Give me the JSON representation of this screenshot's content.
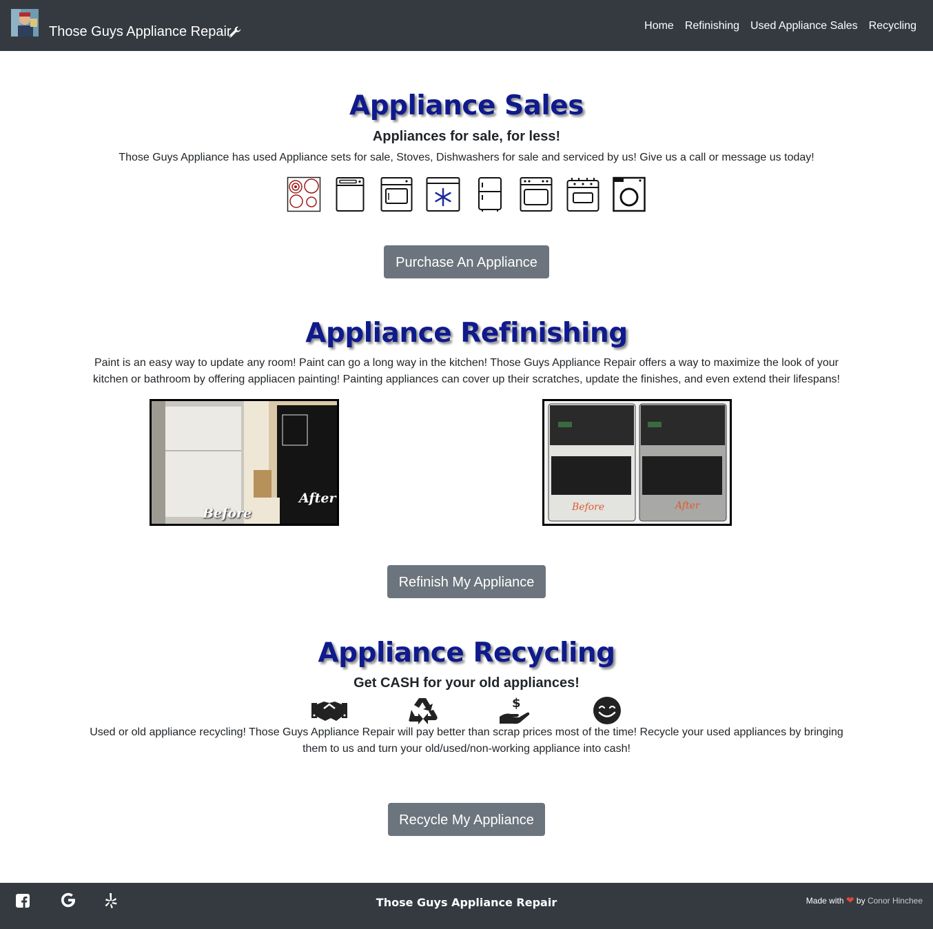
{
  "navbar": {
    "brand": "Those Guys Appliance Repair",
    "links": [
      "Home",
      "Refinishing",
      "Used Appliance Sales",
      "Recycling"
    ]
  },
  "sales": {
    "title": "Appliance Sales",
    "subtitle": "Appliances for sale, for less!",
    "text": "Those Guys Appliance has used Appliance sets for sale, Stoves, Dishwashers for sale and serviced by us! Give us a call or message us today!",
    "icons": [
      "cooktop-icon",
      "dishwasher-icon",
      "oven-icon",
      "freezer-icon",
      "fridge-icon",
      "wall-oven-icon",
      "stove-icon",
      "washer-icon"
    ],
    "button": "Purchase An Appliance"
  },
  "refinishing": {
    "title": "Appliance Refinishing",
    "text": "Paint is an easy way to update any room! Paint can go a long way in the kitchen! Those Guys Appliance Repair offers a way to maximize the look of your kitchen or bathroom by offering appliacen painting! Painting appliances can cover up their scratches, update the finishes, and even extend their lifespans!",
    "photo1": {
      "before": "Before",
      "after": "After"
    },
    "photo2": {
      "before": "Before",
      "after": "After"
    },
    "button": "Refinish My Appliance"
  },
  "recycling": {
    "title": "Appliance Recycling",
    "subtitle": "Get CASH for your old appliances!",
    "icons": [
      "handshake-icon",
      "recycle-icon",
      "money-hand-icon",
      "smile-icon"
    ],
    "text": "Used or old appliance recycling! Those Guys Appliance Repair will pay better than scrap prices most of the time! Recycle your used appliances by bringing them to us and turn your old/used/non-working appliance into cash!",
    "button": "Recycle My Appliance"
  },
  "footer": {
    "social": [
      "facebook-icon",
      "google-icon",
      "yelp-icon"
    ],
    "title": "Those Guys Appliance Repair",
    "made_with": "Made with",
    "by": "by",
    "author": "Conor Hinchee"
  },
  "colors": {
    "navbar": "#343a40",
    "heading": "#0f1a8c",
    "button": "#6c757d"
  }
}
